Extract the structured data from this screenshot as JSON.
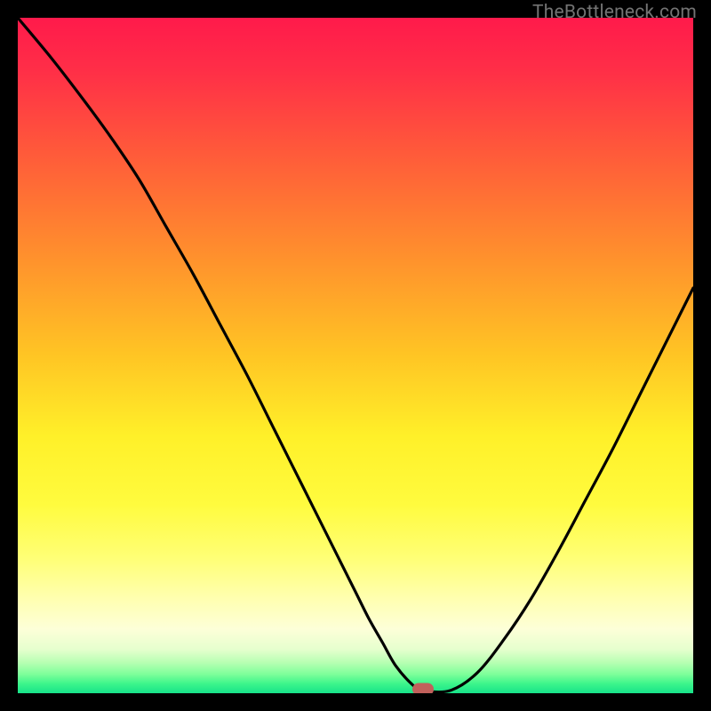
{
  "watermark": "TheBottleneck.com",
  "chart_data": {
    "type": "line",
    "title": "",
    "xlabel": "",
    "ylabel": "",
    "xlim": [
      0,
      100
    ],
    "ylim": [
      0,
      100
    ],
    "series": [
      {
        "name": "curve",
        "x": [
          0,
          5,
          10,
          14,
          18,
          22,
          26,
          30,
          34,
          38,
          42,
          46,
          50,
          52,
          54,
          56,
          58.5,
          60,
          64,
          68,
          72,
          76,
          80,
          84,
          88,
          92,
          96,
          100
        ],
        "y": [
          100,
          94,
          87.5,
          82,
          76,
          69,
          62,
          54.5,
          47,
          39,
          31,
          23,
          15,
          11,
          7.5,
          4,
          1.2,
          0.4,
          0.4,
          3,
          8,
          14,
          21,
          28.5,
          36,
          44,
          52,
          60
        ]
      }
    ],
    "marker": {
      "x": 60,
      "y": 0.6,
      "color": "#c1605b"
    },
    "gradient_stops": [
      {
        "offset": 0.0,
        "color": "#ff1a4b"
      },
      {
        "offset": 0.08,
        "color": "#ff2f47"
      },
      {
        "offset": 0.2,
        "color": "#ff5a3a"
      },
      {
        "offset": 0.35,
        "color": "#ff8f2d"
      },
      {
        "offset": 0.5,
        "color": "#ffc524"
      },
      {
        "offset": 0.62,
        "color": "#fff029"
      },
      {
        "offset": 0.72,
        "color": "#fffb3e"
      },
      {
        "offset": 0.8,
        "color": "#ffff76"
      },
      {
        "offset": 0.86,
        "color": "#ffffb0"
      },
      {
        "offset": 0.905,
        "color": "#fdffd8"
      },
      {
        "offset": 0.935,
        "color": "#e6ffce"
      },
      {
        "offset": 0.955,
        "color": "#b6ffb2"
      },
      {
        "offset": 0.972,
        "color": "#7dff9a"
      },
      {
        "offset": 0.986,
        "color": "#3cf58b"
      },
      {
        "offset": 1.0,
        "color": "#17e38a"
      }
    ]
  }
}
